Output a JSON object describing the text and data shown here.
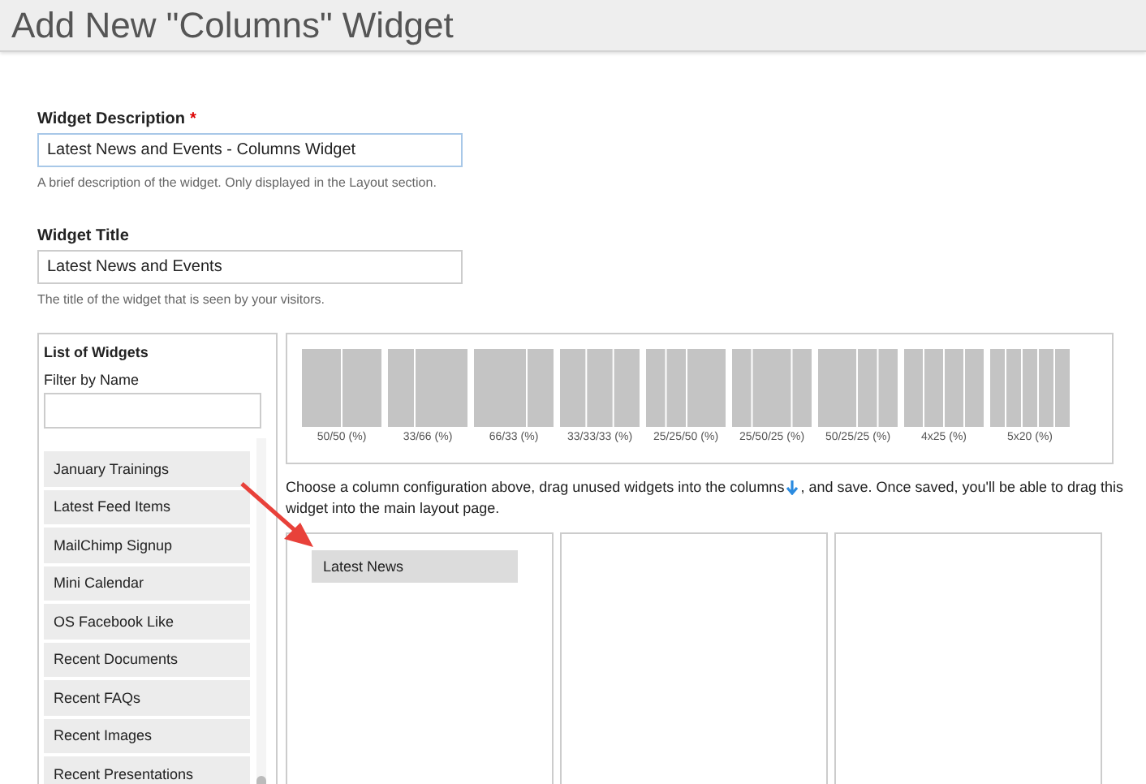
{
  "header": {
    "title": "Add New \"Columns\" Widget"
  },
  "description_field": {
    "label": "Widget Description",
    "required_mark": "*",
    "value": "Latest News and Events - Columns Widget",
    "help": "A brief description of the widget. Only displayed in the Layout section."
  },
  "title_field": {
    "label": "Widget Title",
    "value": "Latest News and Events",
    "help": "The title of the widget that is seen by your visitors."
  },
  "widget_list": {
    "title": "List of Widgets",
    "filter_label": "Filter by Name",
    "items": [
      {
        "label": "January Trainings"
      },
      {
        "label": "Latest Feed Items"
      },
      {
        "label": "MailChimp Signup"
      },
      {
        "label": "Mini Calendar"
      },
      {
        "label": "OS Facebook Like"
      },
      {
        "label": "Recent Documents"
      },
      {
        "label": "Recent FAQs"
      },
      {
        "label": "Recent Images"
      },
      {
        "label": "Recent Presentations"
      }
    ]
  },
  "layouts": [
    {
      "label": "50/50 (%)",
      "kind": "halves"
    },
    {
      "label": "33/66 (%)",
      "kind": "thirdleft"
    },
    {
      "label": "66/33 (%)",
      "kind": "thirdright"
    },
    {
      "label": "33/33/33 (%)",
      "kind": "thirds"
    },
    {
      "label": "25/25/50 (%)",
      "kind": "quartersleft"
    },
    {
      "label": "25/50/25 (%)",
      "kind": "quartersmid"
    },
    {
      "label": "50/25/25 (%)",
      "kind": "quartersright"
    },
    {
      "label": "4x25 (%)",
      "kind": "fourths"
    },
    {
      "label": "5x20 (%)",
      "kind": "fifths"
    }
  ],
  "instructions": {
    "before_icon": "Choose a column configuration above, drag unused widgets into the columns",
    "after_icon": ", and save. Once saved, you'll be able to drag this",
    "second_line": "widget into the main layout page."
  },
  "columns": [
    {
      "widgets": [
        {
          "label": "Latest News"
        }
      ]
    },
    {},
    {}
  ]
}
